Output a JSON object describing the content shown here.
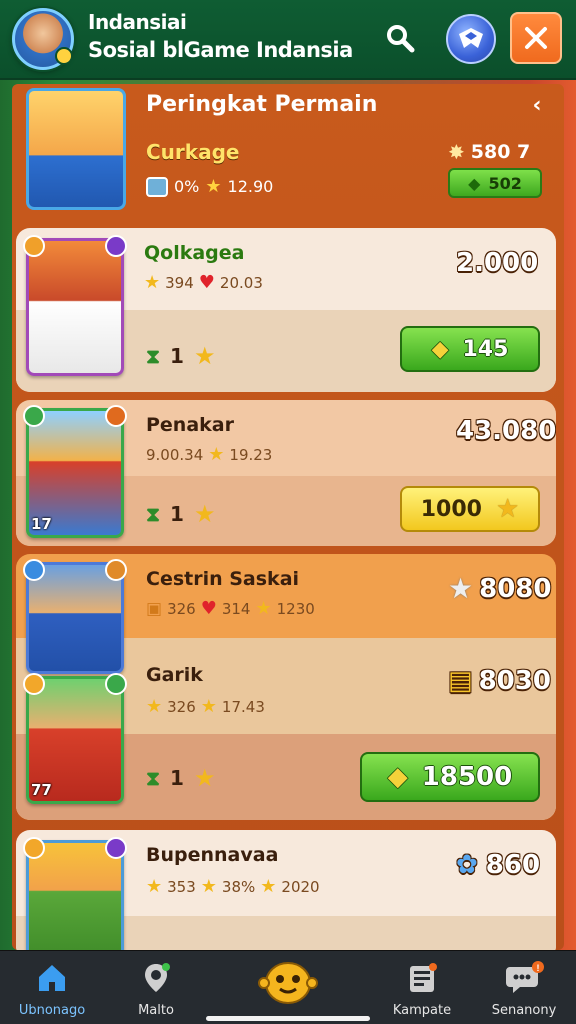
{
  "header": {
    "app_name": "Indansiai",
    "app_subtitle": "Sosial blGame Indansia",
    "icons": [
      "avatar",
      "search-icon",
      "emblem-icon",
      "close-icon"
    ],
    "colors": {
      "bar": "#0f5d33",
      "close": "#f06a1e",
      "emblem": "#3a62d8"
    }
  },
  "panel": {
    "title": "Peringkat Permain",
    "back_icon": "chevron-left-icon",
    "player": {
      "name": "Curkage",
      "stat_pct": "0%",
      "stat_stars": "12.90",
      "points": "580 7",
      "green_value": "502"
    }
  },
  "rows": [
    {
      "name": "Qolkagea",
      "stat_a": "394",
      "stat_b": "20.03",
      "score": "2.000",
      "rank": "1",
      "button": "145",
      "button_style": "green"
    },
    {
      "name": "Penakar",
      "stat_a": "9.00.34",
      "stat_b": "19.23",
      "score": "43.080",
      "rank": "1",
      "button": "1000",
      "button_style": "yellow",
      "level": "17"
    },
    {
      "name": "Cestrin Saskai",
      "stat_a": "326",
      "stat_b": "314",
      "stat_c": "1230",
      "score": "8080",
      "second_name": "Garik",
      "second_stat_a": "326",
      "second_stat_b": "17.43",
      "second_score": "8030",
      "rank": "1",
      "button": "18500",
      "button_style": "green",
      "level": "77"
    },
    {
      "name": "Bupennavaa",
      "stat_a": "353",
      "stat_b": "38%",
      "stat_c": "2020",
      "score": "860"
    }
  ],
  "bottom_nav": [
    {
      "label": "Ubnonago",
      "icon": "home-icon"
    },
    {
      "label": "Malto",
      "icon": "map-pin-icon"
    },
    {
      "label": "",
      "icon": "mascot-icon"
    },
    {
      "label": "Kampate",
      "icon": "news-icon"
    },
    {
      "label": "Senanony",
      "icon": "chat-icon"
    }
  ]
}
